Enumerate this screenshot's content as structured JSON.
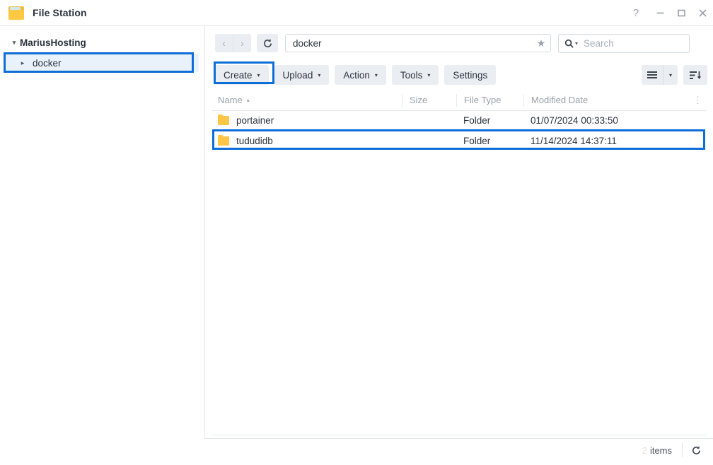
{
  "window": {
    "title": "File Station",
    "app_icon": "folder-icon",
    "controls": {
      "help": "?",
      "minimize": "minimize-icon",
      "maximize": "maximize-icon",
      "close": "close-icon"
    }
  },
  "sidebar": {
    "root": {
      "label": "MariusHosting",
      "expanded": true,
      "twisty": "▾"
    },
    "items": [
      {
        "label": "docker",
        "twisty": "▸",
        "selected": true,
        "highlighted": true
      }
    ]
  },
  "pathbar": {
    "back_icon": "‹",
    "forward_icon": "›",
    "refresh_icon": "refresh-icon",
    "path_value": "docker",
    "star_icon": "★",
    "search_icon": "search-icon",
    "search_caret": "▾",
    "search_placeholder": "Search"
  },
  "toolbar": {
    "buttons": [
      {
        "label": "Create",
        "caret": "▾",
        "highlighted": true
      },
      {
        "label": "Upload",
        "caret": "▾",
        "highlighted": false
      },
      {
        "label": "Action",
        "caret": "▾",
        "highlighted": false
      },
      {
        "label": "Tools",
        "caret": "▾",
        "highlighted": false
      },
      {
        "label": "Settings",
        "caret": "",
        "highlighted": false
      }
    ],
    "view_button": "list-view-icon",
    "view_caret": "▾",
    "sort_button": "sort-descending-icon"
  },
  "table": {
    "columns": [
      {
        "key": "name",
        "label": "Name",
        "sort": "▴"
      },
      {
        "key": "size",
        "label": "Size",
        "sort": ""
      },
      {
        "key": "type",
        "label": "File Type",
        "sort": ""
      },
      {
        "key": "date",
        "label": "Modified Date",
        "sort": ""
      }
    ],
    "column_menu_icon": "⋮",
    "rows": [
      {
        "icon": "folder-icon",
        "name": "portainer",
        "size": "",
        "type": "Folder",
        "date": "01/07/2024 00:33:50",
        "highlighted": false
      },
      {
        "icon": "folder-icon",
        "name": "tududidb",
        "size": "",
        "type": "Folder",
        "date": "11/14/2024 14:37:11",
        "highlighted": true
      }
    ]
  },
  "status": {
    "count": "2",
    "items_label": "items",
    "refresh_icon": "refresh-icon"
  },
  "colors": {
    "annotation": "#0d6ed8",
    "folder": "#fdc647",
    "selection": "#e9f2fb",
    "button": "#eaeef2"
  }
}
